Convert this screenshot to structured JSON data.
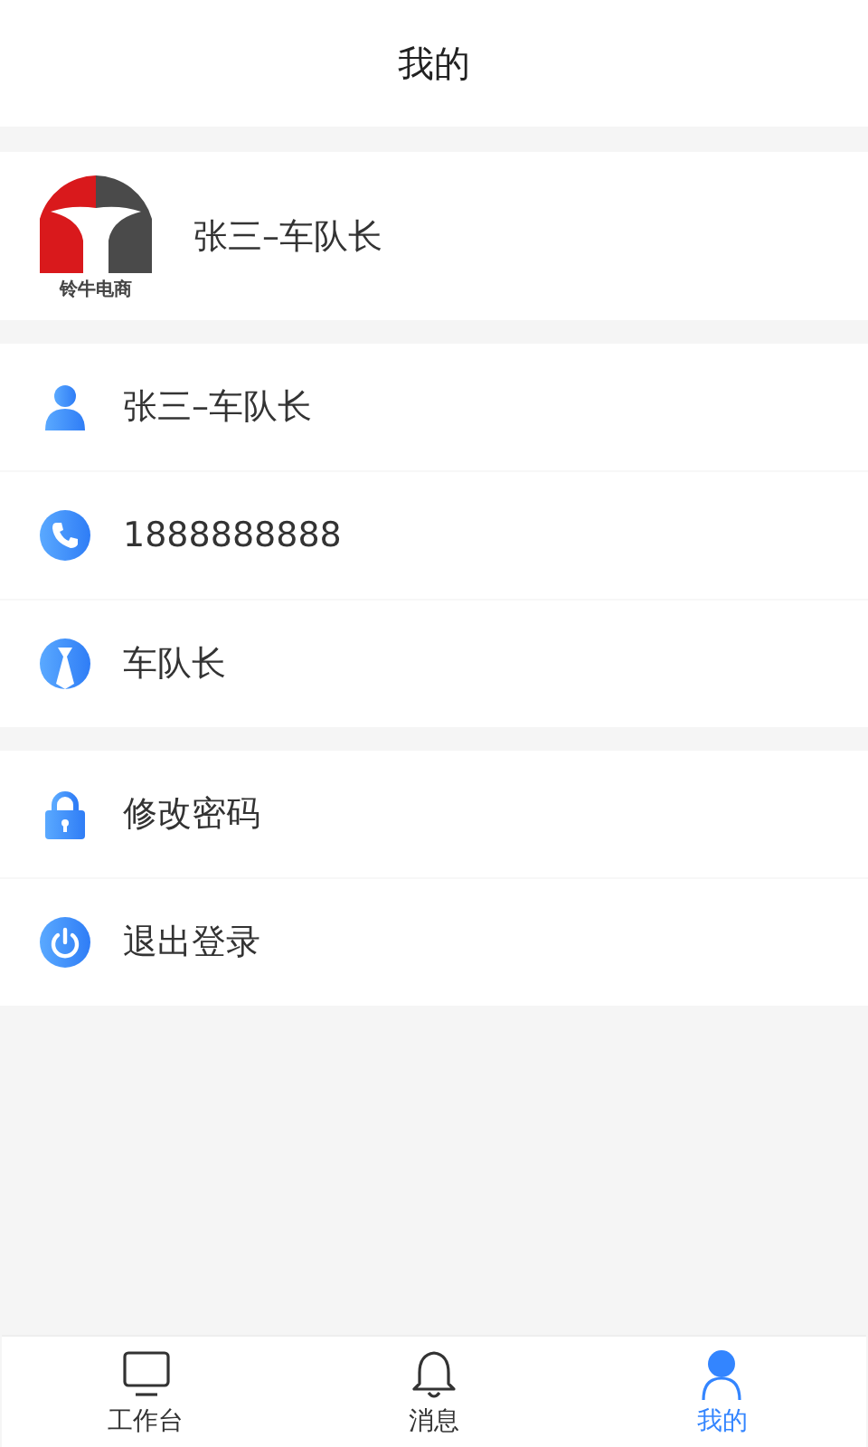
{
  "header": {
    "title": "我的"
  },
  "profile": {
    "logo_text": "铃牛电商",
    "name": "张三–车队长"
  },
  "info_rows": [
    {
      "kind": "person",
      "text": "张三–车队长"
    },
    {
      "kind": "phone",
      "text": "1888888888"
    },
    {
      "kind": "role",
      "text": "车队长"
    }
  ],
  "action_rows": [
    {
      "kind": "lock",
      "text": "修改密码"
    },
    {
      "kind": "power",
      "text": "退出登录"
    }
  ],
  "tab_bar": [
    {
      "kind": "monitor",
      "label": "工作台",
      "selected": false
    },
    {
      "kind": "bell",
      "label": "消息",
      "selected": false
    },
    {
      "kind": "user",
      "label": "我的",
      "selected": true
    }
  ]
}
